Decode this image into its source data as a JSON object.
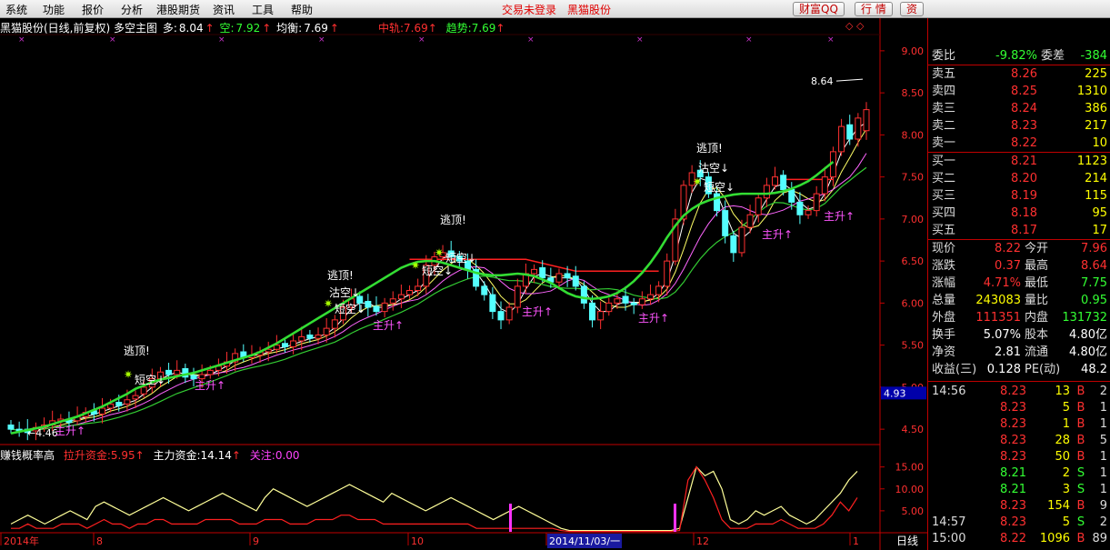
{
  "menu": {
    "items": [
      "系统",
      "功能",
      "报价",
      "分析",
      "港股期货",
      "资讯",
      "工具",
      "帮助"
    ],
    "notice": "交易未登录",
    "stock_link": "黑猫股份",
    "buttons": [
      "财富QQ",
      "行 情",
      "资"
    ]
  },
  "header": {
    "title": "黑猫股份(日线,前复权) 多空主图",
    "duo_label": "多:",
    "duo_value": "8.04",
    "kong_label": "空:",
    "kong_value": "7.92",
    "junheng_label": "均衡:",
    "junheng_value": "7.69",
    "zhonggui_label": "中轨:",
    "zhonggui_value": "7.69",
    "qushi_label": "趋势:",
    "qushi_value": "7.69"
  },
  "indicator_header": {
    "name": "赚钱概率高",
    "lashen_label": "拉升资金:",
    "lashen_value": "5.95",
    "zhuli_label": "主力资金:",
    "zhuli_value": "14.14",
    "guanzhu_label": "关注:",
    "guanzhu_value": "0.00"
  },
  "annotations": {
    "escape_top": "逃顶!",
    "clear_short": "沽空",
    "short_term_short": "短空",
    "main_rise": "主升",
    "high_label": "8.64",
    "low_label": "4.46",
    "cursor_price": "4.93"
  },
  "x_labels": [
    "2014年",
    "8",
    "9",
    "10",
    "2014/11/03/一",
    "12",
    "1"
  ],
  "period_label": "日线",
  "chart_data": {
    "type": "candlestick",
    "y_axis": {
      "ticks": [
        "9.00",
        "8.50",
        "8.00",
        "7.50",
        "7.00",
        "6.50",
        "6.00",
        "5.50",
        "5.00",
        "4.50"
      ],
      "ylim": [
        4.35,
        9.15
      ]
    },
    "sub_y_axis": {
      "ticks": [
        "15.00",
        "10.00",
        "5.00"
      ],
      "ylim": [
        0,
        17
      ]
    },
    "high": 8.64,
    "low": 4.46,
    "closes": [
      4.5,
      4.48,
      4.46,
      4.52,
      4.55,
      4.6,
      4.62,
      4.58,
      4.65,
      4.7,
      4.68,
      4.75,
      4.8,
      4.78,
      4.85,
      4.9,
      5.0,
      5.1,
      5.18,
      5.15,
      5.2,
      5.12,
      5.1,
      5.15,
      5.2,
      5.25,
      5.3,
      5.4,
      5.35,
      5.38,
      5.42,
      5.45,
      5.5,
      5.48,
      5.55,
      5.6,
      5.58,
      5.62,
      5.7,
      5.8,
      5.95,
      6.05,
      6.0,
      5.95,
      5.9,
      6.0,
      6.05,
      6.1,
      6.15,
      6.2,
      6.45,
      6.55,
      6.6,
      6.55,
      6.5,
      6.4,
      6.2,
      6.1,
      5.9,
      5.8,
      5.95,
      6.2,
      6.35,
      6.4,
      6.3,
      6.25,
      6.35,
      6.3,
      6.2,
      6.0,
      5.8,
      5.9,
      6.0,
      6.05,
      6.0,
      5.98,
      6.05,
      6.1,
      6.2,
      6.5,
      7.0,
      7.4,
      7.55,
      7.5,
      7.3,
      7.1,
      6.8,
      6.6,
      6.9,
      7.05,
      7.25,
      7.4,
      7.5,
      7.35,
      7.2,
      7.05,
      7.1,
      7.3,
      7.5,
      7.8,
      8.1,
      7.95,
      8.2,
      8.3
    ],
    "opens": [
      4.55,
      4.5,
      4.5,
      4.48,
      4.52,
      4.55,
      4.6,
      4.62,
      4.6,
      4.65,
      4.72,
      4.68,
      4.75,
      4.82,
      4.8,
      4.86,
      4.92,
      5.0,
      5.1,
      5.2,
      5.15,
      5.22,
      5.14,
      5.1,
      5.15,
      5.2,
      5.25,
      5.3,
      5.42,
      5.35,
      5.38,
      5.42,
      5.45,
      5.52,
      5.48,
      5.55,
      5.62,
      5.58,
      5.62,
      5.7,
      5.8,
      5.95,
      6.08,
      6.02,
      5.96,
      5.9,
      6.0,
      6.05,
      6.1,
      6.15,
      6.2,
      6.45,
      6.55,
      6.62,
      6.56,
      6.5,
      6.4,
      6.2,
      6.1,
      5.9,
      5.8,
      5.95,
      6.2,
      6.35,
      6.42,
      6.3,
      6.25,
      6.35,
      6.32,
      6.2,
      6.0,
      5.8,
      5.9,
      6.0,
      6.08,
      6.0,
      5.98,
      6.05,
      6.1,
      6.2,
      6.5,
      7.0,
      7.4,
      7.58,
      7.5,
      7.3,
      7.1,
      6.8,
      6.6,
      6.9,
      7.05,
      7.25,
      7.4,
      7.52,
      7.35,
      7.2,
      7.05,
      7.1,
      7.3,
      7.5,
      7.8,
      8.12,
      7.95,
      8.05
    ],
    "ma_green": [
      4.45,
      4.47,
      4.49,
      4.51,
      4.53,
      4.56,
      4.59,
      4.62,
      4.65,
      4.69,
      4.73,
      4.77,
      4.82,
      4.87,
      4.92,
      4.98,
      5.02,
      5.06,
      5.09,
      5.11,
      5.13,
      5.15,
      5.17,
      5.2,
      5.23,
      5.26,
      5.29,
      5.32,
      5.35,
      5.38,
      5.42,
      5.47,
      5.52,
      5.58,
      5.64,
      5.7,
      5.76,
      5.82,
      5.88,
      5.94,
      6.0,
      6.06,
      6.12,
      6.18,
      6.24,
      6.3,
      6.36,
      6.42,
      6.46,
      6.49,
      6.5,
      6.5,
      6.48,
      6.45,
      6.42,
      6.39,
      6.36,
      6.34,
      6.33,
      6.33,
      6.34,
      6.35,
      6.34,
      6.32,
      6.28,
      6.24,
      6.18,
      6.12,
      6.08,
      6.06,
      6.05,
      6.06,
      6.08,
      6.12,
      6.18,
      6.26,
      6.36,
      6.48,
      6.62,
      6.78,
      6.92,
      7.04,
      7.12,
      7.18,
      7.22,
      7.25,
      7.27,
      7.29,
      7.3,
      7.3,
      7.3,
      7.3,
      7.31,
      7.33,
      7.36,
      7.4,
      7.45,
      7.52,
      7.6,
      7.68
    ],
    "indicator_yellow": [
      2,
      3,
      4,
      3,
      2,
      3,
      4,
      5,
      4,
      3,
      6,
      7,
      6,
      5,
      4,
      5,
      6,
      7,
      8,
      7,
      6,
      5,
      6,
      7,
      8,
      9,
      8,
      7,
      6,
      5,
      8,
      10,
      9,
      8,
      7,
      6,
      7,
      8,
      9,
      10,
      11,
      10,
      9,
      8,
      7,
      9,
      8,
      7,
      6,
      5,
      6,
      7,
      8,
      7,
      6,
      5,
      4,
      3,
      4,
      5,
      6,
      5,
      4,
      3,
      2,
      1,
      0.5,
      0.5,
      0.5,
      0.5,
      0.5,
      0.5,
      0.5,
      0.5,
      0.5,
      0.5,
      0.5,
      0.5,
      0.5,
      1,
      8,
      15,
      13,
      14,
      10,
      3,
      2,
      3,
      5,
      4,
      5,
      6,
      4,
      3,
      2,
      3,
      5,
      7,
      9,
      12,
      14
    ],
    "indicator_red": [
      1,
      1,
      2,
      1,
      1,
      1,
      2,
      2,
      2,
      1,
      2,
      3,
      2,
      2,
      1,
      2,
      2,
      3,
      3,
      2,
      2,
      2,
      2,
      3,
      3,
      3,
      3,
      2,
      2,
      2,
      3,
      3,
      3,
      2,
      2,
      2,
      3,
      3,
      3,
      4,
      4,
      3,
      3,
      3,
      2,
      2,
      2,
      2,
      2,
      2,
      2,
      2,
      2,
      2,
      2,
      1,
      1,
      1,
      1,
      1,
      1,
      1,
      1,
      1,
      1,
      0.5,
      0.3,
      0.3,
      0.3,
      0.3,
      0.3,
      0.3,
      0.3,
      0.3,
      0.3,
      0.3,
      0.3,
      0.3,
      0.3,
      0.5,
      12,
      15,
      12,
      8,
      3,
      1,
      1,
      1,
      2,
      2,
      2,
      3,
      2,
      1,
      1,
      1,
      2,
      4,
      7,
      5,
      8
    ]
  },
  "quote": {
    "weibi_label": "委比",
    "weibi_value": "-9.82%",
    "weicha_label": "委差",
    "weicha_value": "-384",
    "asks": [
      {
        "label": "卖五",
        "price": "8.26",
        "vol": "225"
      },
      {
        "label": "卖四",
        "price": "8.25",
        "vol": "1310"
      },
      {
        "label": "卖三",
        "price": "8.24",
        "vol": "386"
      },
      {
        "label": "卖二",
        "price": "8.23",
        "vol": "217"
      },
      {
        "label": "卖一",
        "price": "8.22",
        "vol": "10"
      }
    ],
    "bids": [
      {
        "label": "买一",
        "price": "8.21",
        "vol": "1123"
      },
      {
        "label": "买二",
        "price": "8.20",
        "vol": "214"
      },
      {
        "label": "买三",
        "price": "8.19",
        "vol": "115"
      },
      {
        "label": "买四",
        "price": "8.18",
        "vol": "95"
      },
      {
        "label": "买五",
        "price": "8.17",
        "vol": "17"
      }
    ],
    "stats": [
      {
        "l1": "现价",
        "v1": "8.22",
        "l2": "今开",
        "v2": "7.96"
      },
      {
        "l1": "涨跌",
        "v1": "0.37",
        "l2": "最高",
        "v2": "8.64"
      },
      {
        "l1": "涨幅",
        "v1": "4.71%",
        "l2": "最低",
        "v2": "7.75"
      },
      {
        "l1": "总量",
        "v1": "243083",
        "l2": "量比",
        "v2": "0.95"
      },
      {
        "l1": "外盘",
        "v1": "111351",
        "l2": "内盘",
        "v2": "131732"
      },
      {
        "l1": "换手",
        "v1": "5.07%",
        "l2": "股本",
        "v2": "4.80亿"
      },
      {
        "l1": "净资",
        "v1": "2.81",
        "l2": "流通",
        "v2": "4.80亿"
      },
      {
        "l1": "收益(三)",
        "v1": "0.128",
        "l2": "PE(动)",
        "v2": "48.2"
      }
    ],
    "ticks": [
      {
        "time": "14:56",
        "price": "8.23",
        "vol": "13",
        "side": "B",
        "n": "2"
      },
      {
        "time": "",
        "price": "8.23",
        "vol": "5",
        "side": "B",
        "n": "1"
      },
      {
        "time": "",
        "price": "8.23",
        "vol": "1",
        "side": "B",
        "n": "1"
      },
      {
        "time": "",
        "price": "8.23",
        "vol": "28",
        "side": "B",
        "n": "5"
      },
      {
        "time": "",
        "price": "8.23",
        "vol": "50",
        "side": "B",
        "n": "1"
      },
      {
        "time": "",
        "price": "8.21",
        "vol": "2",
        "side": "S",
        "n": "1"
      },
      {
        "time": "",
        "price": "8.21",
        "vol": "3",
        "side": "S",
        "n": "1"
      },
      {
        "time": "",
        "price": "8.23",
        "vol": "154",
        "side": "B",
        "n": "9"
      },
      {
        "time": "14:57",
        "price": "8.23",
        "vol": "5",
        "side": "S",
        "n": "2"
      },
      {
        "time": "15:00",
        "price": "8.22",
        "vol": "1096",
        "side": "B",
        "n": "89"
      }
    ]
  }
}
